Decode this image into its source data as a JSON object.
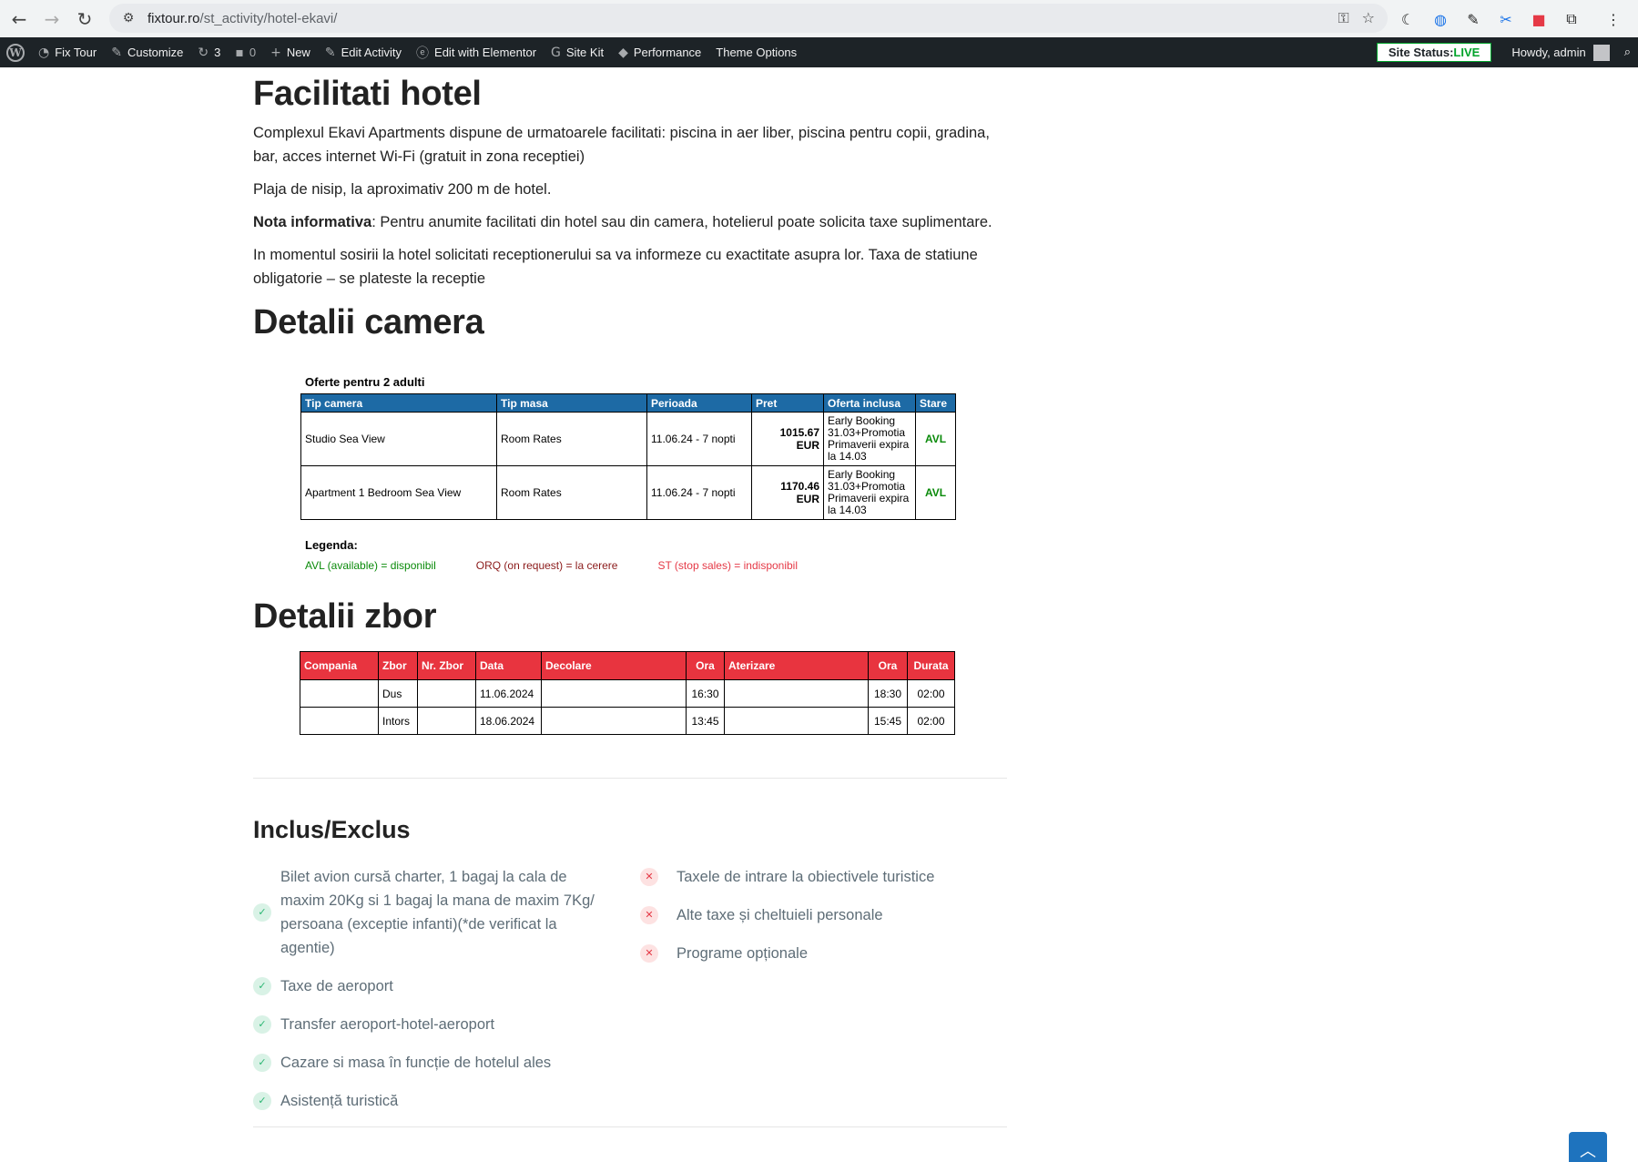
{
  "browser": {
    "url_domain": "fixtour.ro",
    "url_path": "/st_activity/hotel-ekavi/"
  },
  "admin_bar": {
    "site_name": "Fix Tour",
    "customize": "Customize",
    "updates_count": "3",
    "comments_count": "0",
    "new": "New",
    "edit_activity": "Edit Activity",
    "edit_elementor": "Edit with Elementor",
    "site_kit": "Site Kit",
    "performance": "Performance",
    "theme_options": "Theme Options",
    "site_status_label": "Site Status:",
    "site_status_value": "LIVE",
    "howdy": "Howdy, admin"
  },
  "facilities": {
    "title": "Facilitati hotel",
    "p1": "Complexul Ekavi Apartments dispune de urmatoarele facilitati: piscina in aer liber, piscina pentru copii, gradina, bar, acces internet Wi-Fi (gratuit in zona receptiei)",
    "p2": "Plaja de nisip, la aproximativ 200 m de hotel.",
    "note_label": "Nota informativa",
    "note_text": ": Pentru anumite facilitati din hotel sau din camera, hotelierul poate solicita taxe suplimentare.",
    "p4": "In momentul sosirii la hotel solicitati receptionerului sa va informeze cu exactitate asupra lor. Taxa de statiune obligatorie – se plateste la receptie"
  },
  "room": {
    "title": "Detalii camera",
    "caption": "Oferte pentru 2 adulti",
    "headers": [
      "Tip camera",
      "Tip masa",
      "Perioada",
      "Pret",
      "Oferta inclusa",
      "Stare"
    ],
    "rows": [
      {
        "room": "Studio Sea View",
        "meal": "Room Rates",
        "period": "11.06.24 - 7 nopti",
        "price": "1015.67",
        "currency": "EUR",
        "offer": "Early Booking 31.03+Promotia Primaverii expira la 14.03",
        "status": "AVL"
      },
      {
        "room": "Apartment 1 Bedroom Sea View",
        "meal": "Room Rates",
        "period": "11.06.24 - 7 nopti",
        "price": "1170.46",
        "currency": "EUR",
        "offer": "Early Booking 31.03+Promotia Primaverii expira la 14.03",
        "status": "AVL"
      }
    ],
    "legend_title": "Legenda:",
    "legend_avl": "AVL (available) = disponibil",
    "legend_orq": "ORQ (on request) = la cerere",
    "legend_st": "ST (stop sales) = indisponibil"
  },
  "flight": {
    "title": "Detalii zbor",
    "headers": [
      "Compania",
      "Zbor",
      "Nr. Zbor",
      "Data",
      "Decolare",
      "Ora",
      "Aterizare",
      "Ora",
      "Durata"
    ],
    "rows": [
      {
        "company": "",
        "flight": "Dus",
        "number": "",
        "date": "11.06.2024",
        "departure": "",
        "dep_time": "16:30",
        "arrival": "",
        "arr_time": "18:30",
        "duration": "02:00"
      },
      {
        "company": "",
        "flight": "Intors",
        "number": "",
        "date": "18.06.2024",
        "departure": "",
        "dep_time": "13:45",
        "arrival": "",
        "arr_time": "15:45",
        "duration": "02:00"
      }
    ]
  },
  "included": {
    "title": "Inclus/Exclus",
    "included_items": [
      "Bilet avion cursă charter, 1 bagaj la cala de maxim 20Kg si 1 bagaj la mana de maxim 7Kg/ persoana (exceptie infanti)(*de verificat la agentie)",
      "Taxe de aeroport",
      "Transfer aeroport-hotel-aeroport",
      "Cazare si masa în funcție de hotelul ales",
      "Asistență turistică"
    ],
    "excluded_items": [
      "Taxele de intrare la obiectivele turistice",
      "Alte taxe și cheltuieli personale",
      "Programe opționale"
    ]
  },
  "colors": {
    "room_header": "#1d6aa5",
    "flight_header": "#e8343f",
    "avl": "#0a8a0a"
  }
}
